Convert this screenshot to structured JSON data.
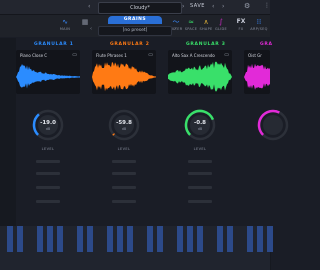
{
  "app": {
    "logo": "nDust",
    "logo_sub": "SYNTHESIZER"
  },
  "topbar": {
    "preset_name": "Cloudy*",
    "save_label": "SAVE",
    "prev_symbol": "‹",
    "next_symbol": "›",
    "menu_symbol": "⋮",
    "gear_symbol": "⚙"
  },
  "subbar": {
    "modes": [
      {
        "label": "GRAINS",
        "icon": "grains-icon"
      },
      {
        "label": "MOD",
        "icon": "mod-icon"
      },
      {
        "label": "FILTER",
        "icon": "filter-icon"
      },
      {
        "label": "SPACE",
        "icon": "space-icon"
      },
      {
        "label": "SHAPE",
        "icon": "shape-icon"
      },
      {
        "label": "GLIDE",
        "icon": "glide-icon"
      },
      {
        "label": "FX",
        "icon": "fx-icon"
      },
      {
        "label": "ARP/SEQ",
        "icon": "arp-icon"
      }
    ],
    "left_items": [
      {
        "label": "MAIN",
        "icon": "waveform-icon"
      },
      {
        "label": "",
        "icon": "grid-icon"
      }
    ],
    "grains_label": "GRAINS",
    "preset_sub": "[no preset]"
  },
  "granulars": [
    {
      "title": "GRANULAR 1",
      "sample": "Piano Close C",
      "color": "#2b8cff",
      "knob_value": "-19.0",
      "knob_unit": "dB",
      "knob_label": "LEVEL",
      "level": 0.35
    },
    {
      "title": "GRANULAR 2",
      "sample": "Flute Phrases 1",
      "color": "#ff7a14",
      "knob_value": "-59.8",
      "knob_unit": "dB",
      "knob_label": "LEVEL",
      "level": 0.02
    },
    {
      "title": "GRANULAR 3",
      "sample": "Alto Sax A Crescendo",
      "color": "#39e06a",
      "knob_value": "-0.8",
      "knob_unit": "dB",
      "knob_label": "LEVEL",
      "level": 0.75
    },
    {
      "title": "GRA",
      "sample": "Oist Gr",
      "color": "#e22ad8",
      "knob_value": "",
      "knob_unit": "",
      "knob_label": "",
      "level": 0.6
    }
  ],
  "colors": {
    "bg": "#1a1d26",
    "accent": "#2a6fd6"
  }
}
